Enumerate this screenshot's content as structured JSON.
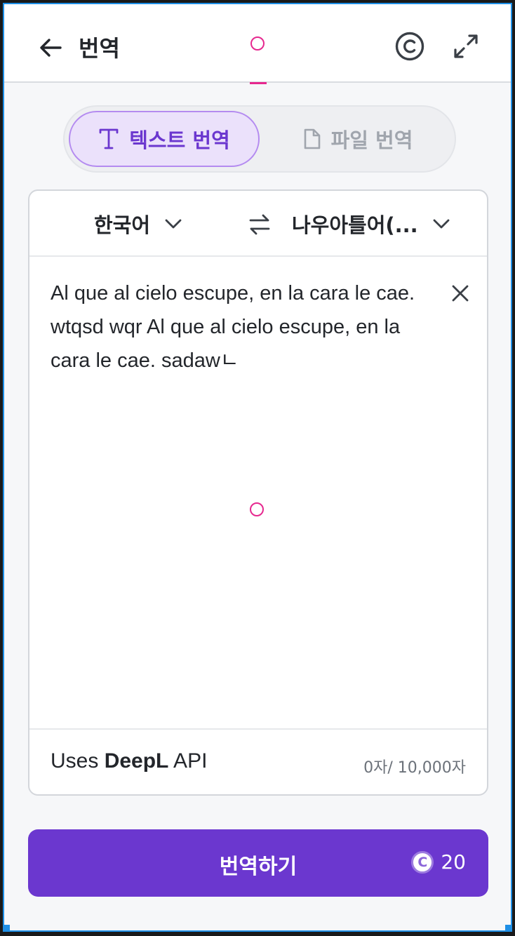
{
  "header": {
    "title": "번역",
    "back_icon": "arrow-left-icon",
    "credit_icon": "copyright-icon",
    "expand_icon": "expand-icon"
  },
  "tabs": [
    {
      "label": "텍스트 번역",
      "icon": "text-t-icon",
      "active": true
    },
    {
      "label": "파일 번역",
      "icon": "file-icon",
      "active": false
    }
  ],
  "languages": {
    "source": "한국어",
    "target": "나우아틀어(...",
    "swap_icon": "swap-icon"
  },
  "input": {
    "lines": [
      "Al que al cielo escupe, en la cara le cae.",
      "wtqsd wqr Al que al cielo escupe, en la",
      "cara le cae. sadawㄴ"
    ],
    "clear_icon": "close-icon"
  },
  "footer": {
    "uses_prefix": "Uses ",
    "uses_brand": "DeepL",
    "uses_suffix": " API",
    "char_count": "0자/ 10,000자"
  },
  "action": {
    "label": "번역하기",
    "coin_letter": "C",
    "cost": "20"
  },
  "colors": {
    "accent": "#6b37cf",
    "accent_light": "#ebe1fb",
    "marker": "#e6288f",
    "frame": "#1e8fe6"
  }
}
